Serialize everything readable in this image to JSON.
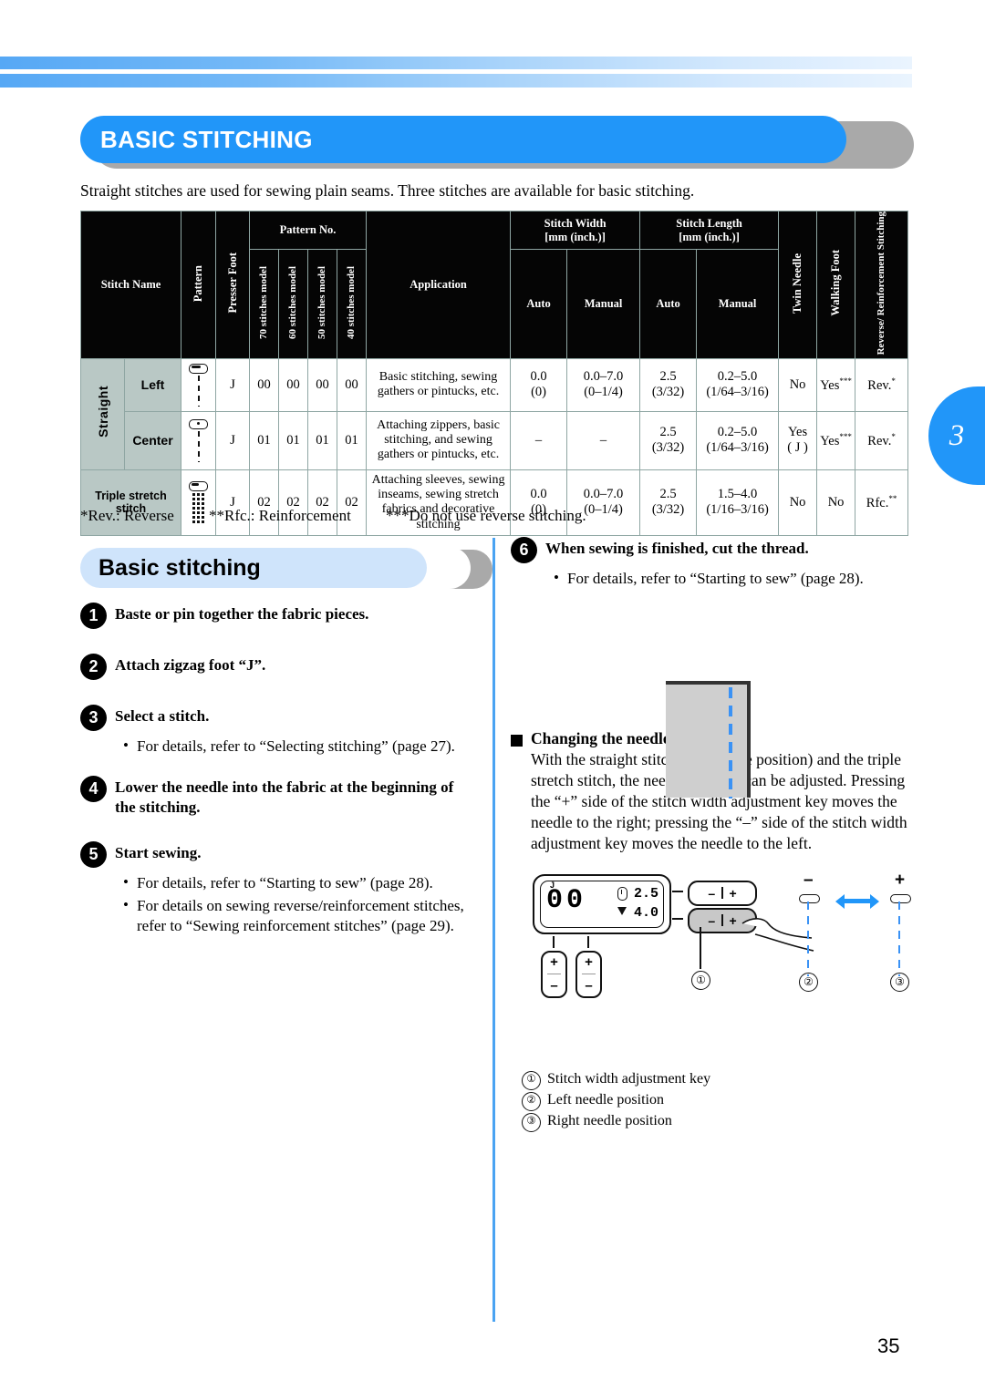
{
  "chapter_tab": "3",
  "page_number": "35",
  "title": "BASIC STITCHING",
  "intro": "Straight stitches are used for sewing plain seams. Three stitches are available for basic stitching.",
  "table": {
    "headers": {
      "stitch_name": "Stitch Name",
      "pattern": "Pattern",
      "presser_foot": "Presser Foot",
      "pattern_no": "Pattern No.",
      "models": [
        "70 stitches model",
        "60 stitches model",
        "50 stitches model",
        "40 stitches model"
      ],
      "application": "Application",
      "stitch_width": "Stitch Width",
      "stitch_width_unit": "[mm (inch.)]",
      "stitch_length": "Stitch Length",
      "stitch_length_unit": "[mm (inch.)]",
      "auto": "Auto",
      "manual": "Manual",
      "twin_needle": "Twin Needle",
      "walking_foot": "Walking Foot",
      "reverse_reinforcement": "Reverse/ Reinforcement Stitching"
    },
    "group_label": "Straight",
    "rows": [
      {
        "name": "Left",
        "presser_foot": "J",
        "pattern_no": [
          "00",
          "00",
          "00",
          "00"
        ],
        "application": "Basic stitching, sewing gathers or pintucks, etc.",
        "width_auto": "0.0",
        "width_auto_inch": "(0)",
        "width_manual": "0.0–7.0",
        "width_manual_inch": "(0–1/4)",
        "length_auto": "2.5",
        "length_auto_inch": "(3/32)",
        "length_manual": "0.2–5.0",
        "length_manual_inch": "(1/64–3/16)",
        "twin_needle": "No",
        "twin_needle_sub": "",
        "walking_foot": "Yes",
        "walking_foot_mark": "***",
        "reverse": "Rev.",
        "reverse_mark": "*"
      },
      {
        "name": "Center",
        "presser_foot": "J",
        "pattern_no": [
          "01",
          "01",
          "01",
          "01"
        ],
        "application": "Attaching zippers, basic stitching, and sewing gathers or pintucks, etc.",
        "width_auto": "–",
        "width_auto_inch": "",
        "width_manual": "–",
        "width_manual_inch": "",
        "length_auto": "2.5",
        "length_auto_inch": "(3/32)",
        "length_manual": "0.2–5.0",
        "length_manual_inch": "(1/64–3/16)",
        "twin_needle": "Yes",
        "twin_needle_sub": "( J )",
        "walking_foot": "Yes",
        "walking_foot_mark": "***",
        "reverse": "Rev.",
        "reverse_mark": "*"
      },
      {
        "name": "Triple stretch stitch",
        "presser_foot": "J",
        "pattern_no": [
          "02",
          "02",
          "02",
          "02"
        ],
        "application": "Attaching sleeves, sewing inseams, sewing stretch fabrics and decorative stitching",
        "width_auto": "0.0",
        "width_auto_inch": "(0)",
        "width_manual": "0.0–7.0",
        "width_manual_inch": "(0–1/4)",
        "length_auto": "2.5",
        "length_auto_inch": "(3/32)",
        "length_manual": "1.5–4.0",
        "length_manual_inch": "(1/16–3/16)",
        "twin_needle": "No",
        "twin_needle_sub": "",
        "walking_foot": "No",
        "walking_foot_mark": "",
        "reverse": "Rfc.",
        "reverse_mark": "**"
      }
    ]
  },
  "footnotes": [
    "*Rev.: Reverse",
    "**Rfc.: Reinforcement",
    "***Do not use reverse stitching."
  ],
  "section_title": "Basic stitching",
  "steps_left": [
    {
      "num": "1",
      "title": "Baste or pin together the fabric pieces.",
      "bullets": []
    },
    {
      "num": "2",
      "title": "Attach zigzag foot “J”.",
      "bullets": []
    },
    {
      "num": "3",
      "title": "Select a stitch.",
      "bullets": [
        "For details, refer to “Selecting stitching” (page 27)."
      ]
    },
    {
      "num": "4",
      "title": "Lower the needle into the fabric at the beginning of the stitching.",
      "bullets": []
    },
    {
      "num": "5",
      "title": "Start sewing.",
      "bullets": [
        "For details, refer to “Starting to sew” (page 28).",
        "For details on sewing reverse/reinforcement stitches, refer to “Sewing reinforcement stitches” (page 29)."
      ]
    }
  ],
  "steps_right": [
    {
      "num": "6",
      "title": "When sewing is finished, cut the thread.",
      "bullets": [
        "For details, refer to “Starting to sew” (page 28)."
      ]
    }
  ],
  "needle_section": {
    "heading": "Changing the needle position",
    "body": "With the straight stitch (left needle position) and the triple stretch stitch, the needle position can be adjusted. Pressing the “+” side of the stitch width adjustment key moves the needle to the right; pressing the “–” side of the stitch width adjustment key moves the needle to the left."
  },
  "lcd": {
    "foot_code": "J",
    "pattern_number": "00",
    "width_value": "2.5",
    "length_value": "4.0"
  },
  "keys": {
    "minus": "–",
    "plus": "+"
  },
  "diagram_labels": {
    "left_sign": "–",
    "right_sign": "+",
    "c1": "①",
    "c2": "②",
    "c3": "③"
  },
  "legend": [
    {
      "num": "①",
      "text": "Stitch width adjustment key"
    },
    {
      "num": "②",
      "text": "Left needle position"
    },
    {
      "num": "③",
      "text": "Right needle position"
    }
  ]
}
